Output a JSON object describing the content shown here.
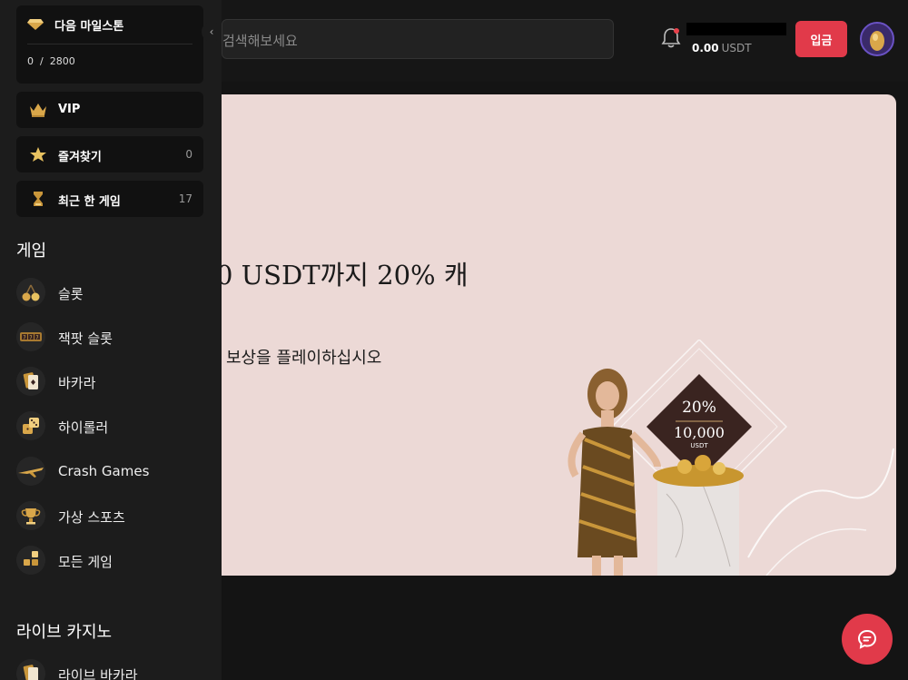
{
  "header": {
    "search_placeholder": "검색해보세요",
    "wallet_amount": "0.00",
    "wallet_currency": "USDT",
    "deposit_label": "입금"
  },
  "banner": {
    "title": "0 USDT까지 20% 캐",
    "subtitle": "보상을 플레이하십시오",
    "badge_percent": "20%",
    "badge_amount": "10,000",
    "badge_currency": "USDT"
  },
  "sidebar": {
    "milestone": {
      "title": "다음 마일스톤",
      "current": "0",
      "separator": "/",
      "target": "2800"
    },
    "cards": [
      {
        "label": "VIP",
        "count": ""
      },
      {
        "label": "즐겨찾기",
        "count": "0"
      },
      {
        "label": "최근 한 게임",
        "count": "17"
      }
    ],
    "games_title": "게임",
    "games": [
      {
        "label": "슬롯",
        "icon": "cherries-icon"
      },
      {
        "label": "잭팟 슬롯",
        "icon": "jackpot-slot-icon"
      },
      {
        "label": "바카라",
        "icon": "cards-icon"
      },
      {
        "label": "하이롤러",
        "icon": "dice-icon"
      },
      {
        "label": "Crash Games",
        "icon": "plane-icon"
      },
      {
        "label": "가상 스포츠",
        "icon": "trophy-icon"
      },
      {
        "label": "모든 게임",
        "icon": "grid-icon"
      }
    ],
    "live_title": "라이브 카지노",
    "live": [
      {
        "label": "라이브 바카라",
        "icon": "cards-icon"
      }
    ]
  },
  "colors": {
    "accent": "#e13a4a",
    "sidebar_bg": "#1c1c1c",
    "banner_bg": "#ecd9d6"
  }
}
